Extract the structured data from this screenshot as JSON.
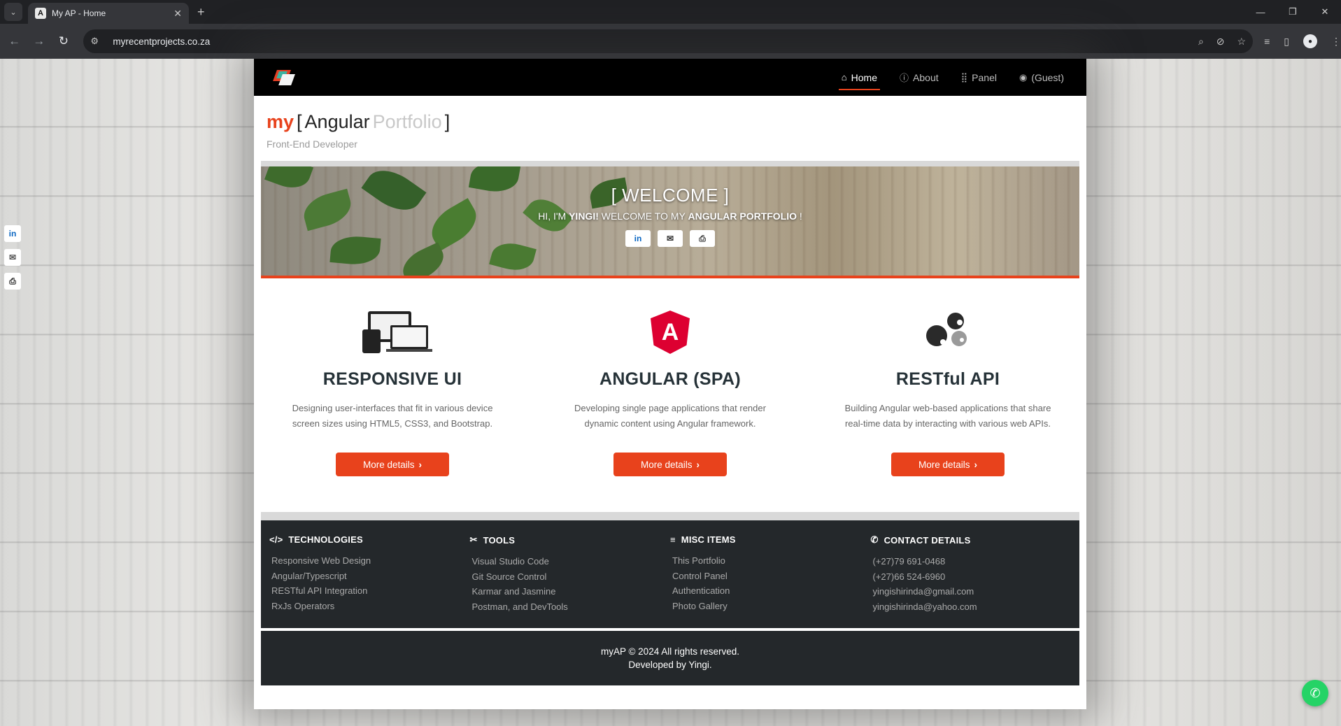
{
  "browser": {
    "tab_title": "My AP - Home",
    "tab_favicon": "A",
    "url": "myrecentprojects.co.za"
  },
  "site_nav": {
    "links": [
      {
        "label": "Home",
        "icon": "home-icon"
      },
      {
        "label": "About",
        "icon": "info-icon"
      },
      {
        "label": "Panel",
        "icon": "grid-icon"
      },
      {
        "label": "(Guest)",
        "icon": "user-circle-icon"
      }
    ]
  },
  "brand": {
    "my": "my",
    "open_bracket": "[",
    "angular": "Angular",
    "portfolio": "Portfolio",
    "close_bracket": "]",
    "tagline": "Front-End Developer"
  },
  "hero": {
    "title": "[ WELCOME ]",
    "sub_prefix": "HI, I'M ",
    "sub_name": "YINGI!",
    "sub_middle": " WELCOME TO MY ",
    "sub_highlight": "ANGULAR PORTFOLIO",
    "sub_suffix": " !"
  },
  "features": [
    {
      "title": "RESPONSIVE UI",
      "desc": "Designing user-interfaces that fit in various device screen sizes using HTML5, CSS3, and Bootstrap.",
      "button": "More details",
      "icon": "devices-icon"
    },
    {
      "title": "ANGULAR (SPA)",
      "desc": "Developing single page applications that render dynamic content using Angular framework.",
      "button": "More details",
      "icon": "angular-icon"
    },
    {
      "title": "RESTful API",
      "desc": "Building Angular web-based applications that share real-time data by interacting with various web APIs.",
      "button": "More details",
      "icon": "gears-icon"
    }
  ],
  "footer": {
    "columns": [
      {
        "heading": "TECHNOLOGIES",
        "icon": "code-icon",
        "items": [
          "Responsive Web Design",
          "Angular/Typescript",
          "RESTful API Integration",
          "RxJs Operators"
        ]
      },
      {
        "heading": "TOOLS",
        "icon": "tools-icon",
        "items": [
          "Visual Studio Code",
          "Git Source Control",
          "Karmar and Jasmine",
          "Postman, and DevTools"
        ]
      },
      {
        "heading": "MISC ITEMS",
        "icon": "menu-icon",
        "items": [
          "This Portfolio",
          "Control Panel",
          "Authentication",
          "Photo Gallery"
        ]
      },
      {
        "heading": "CONTACT DETAILS",
        "icon": "phone-icon",
        "items": [
          "(+27)79 691-0468",
          "(+27)66 524-6960",
          "yingishirinda@gmail.com",
          "yingishirinda@yahoo.com"
        ]
      }
    ],
    "copyright": "myAP © 2024 All rights reserved.",
    "developer": "Developed by Yingi."
  },
  "colors": {
    "accent": "#e8421c",
    "angular_red": "#dd0031",
    "footer_bg": "#24282b"
  }
}
